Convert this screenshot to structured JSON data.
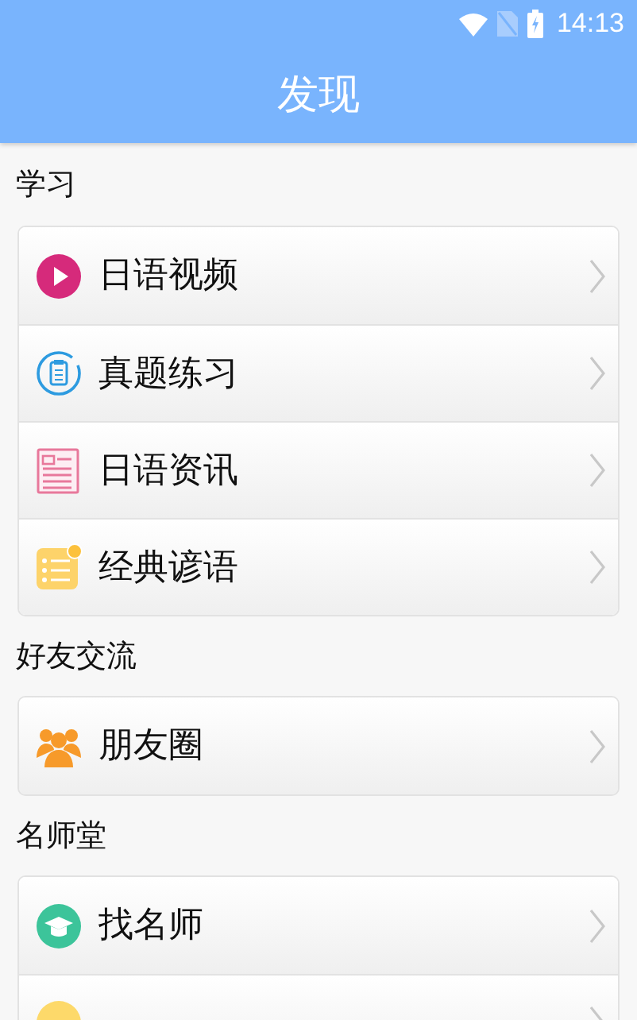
{
  "status_bar": {
    "time": "14:13"
  },
  "header": {
    "title": "发现"
  },
  "sections": [
    {
      "title": "学习",
      "items": [
        {
          "kind": "labeled",
          "label": "日语视频"
        },
        {
          "kind": "labeled",
          "label": "真题练习"
        },
        {
          "kind": "labeled",
          "label": "日语资讯"
        },
        {
          "kind": "labeled",
          "label": "经典谚语"
        }
      ]
    },
    {
      "title": "好友交流",
      "items": [
        {
          "kind": "labeled",
          "label": "朋友圈"
        }
      ]
    },
    {
      "title": "名师堂",
      "items": [
        {
          "kind": "labeled",
          "label": "找名师"
        },
        {
          "kind": "cut_off"
        }
      ]
    }
  ]
}
